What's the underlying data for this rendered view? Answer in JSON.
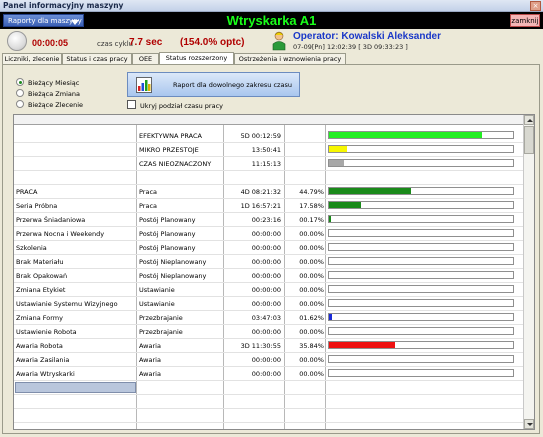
{
  "window": {
    "title": "Panel informacyjny maszyny",
    "close_glyph": "×"
  },
  "topbar": {
    "reports_button": "Raporty dla maszyny",
    "machine_title": "Wtryskarka A1",
    "close_button": "zamknij",
    "title_color": "#19ff19"
  },
  "info": {
    "timer": "00:00:05",
    "cycle_label": "czas cyklu",
    "cycle_value": "7.7 sec",
    "cycle_percent": "(154.0% optc)",
    "operator": "Operator:  Kowalski Aleksander",
    "operator_time": "07-09[Pn] 12:02:39  [ 3D 09:33:23 ]"
  },
  "tabs": [
    {
      "label": "Liczniki, zlecenie"
    },
    {
      "label": "Status i czas pracy"
    },
    {
      "label": "OEE"
    },
    {
      "label": "Status rozszerzony",
      "active": true
    },
    {
      "label": "Ostrzeżenia i wznowienia pracy"
    }
  ],
  "period": {
    "options": [
      "Bieżący Miesiąc",
      "Bieżąca Zmiana",
      "Bieżące Zlecenie"
    ],
    "selected": "Bieżący Miesiąc"
  },
  "report_button": "Raport dla dowolnego zakresu czasu",
  "hide_split_label": "Ukryj podział czasu pracy",
  "table": {
    "summary_rows": [
      {
        "category": "EFEKTYWNA PRACA",
        "time": "5D 00:12:59",
        "percent": "",
        "fraction": 0.83,
        "color": "#22ee22"
      },
      {
        "category": "MIKRO PRZESTOJE",
        "time": "13:50:41",
        "percent": "",
        "fraction": 0.1,
        "color": "#f7f700"
      },
      {
        "category": "CZAS NIEOZNACZONY",
        "time": "11:15:13",
        "percent": "",
        "fraction": 0.08,
        "color": "#a8a8a8"
      }
    ],
    "rows": [
      {
        "name": "PRACA",
        "category": "Praca",
        "time": "4D 08:21:32",
        "percent": "44.79%",
        "fraction": 0.448,
        "color": "#1a8a1a"
      },
      {
        "name": "Seria Próbna",
        "category": "Praca",
        "time": "1D 16:57:21",
        "percent": "17.58%",
        "fraction": 0.176,
        "color": "#1a8a1a"
      },
      {
        "name": "Przerwa Śniadaniowa",
        "category": "Postój Planowany",
        "time": "00:23:16",
        "percent": "00.17%",
        "fraction": 0.0017,
        "color": "#1a8a1a"
      },
      {
        "name": "Przerwa Nocna i Weekendy",
        "category": "Postój Planowany",
        "time": "00:00:00",
        "percent": "00.00%",
        "fraction": 0,
        "color": "#1a8a1a"
      },
      {
        "name": "Szkolenia",
        "category": "Postój Planowany",
        "time": "00:00:00",
        "percent": "00.00%",
        "fraction": 0,
        "color": "#1a8a1a"
      },
      {
        "name": "Brak Materiału",
        "category": "Postój Nieplanowany",
        "time": "00:00:00",
        "percent": "00.00%",
        "fraction": 0,
        "color": "#1a8a1a"
      },
      {
        "name": "Brak Opakowań",
        "category": "Postój Nieplanowany",
        "time": "00:00:00",
        "percent": "00.00%",
        "fraction": 0,
        "color": "#1a8a1a"
      },
      {
        "name": "Zmiana Etykiet",
        "category": "Ustawianie",
        "time": "00:00:00",
        "percent": "00.00%",
        "fraction": 0,
        "color": "#1a8a1a"
      },
      {
        "name": "Ustawianie Systemu Wizyjnego",
        "category": "Ustawianie",
        "time": "00:00:00",
        "percent": "00.00%",
        "fraction": 0,
        "color": "#1a8a1a"
      },
      {
        "name": "Zmiana Formy",
        "category": "Przezbrajanie",
        "time": "03:47:03",
        "percent": "01.62%",
        "fraction": 0.0162,
        "color": "#1a2ad8"
      },
      {
        "name": "Ustawienie Robota",
        "category": "Przezbrajanie",
        "time": "00:00:00",
        "percent": "00.00%",
        "fraction": 0,
        "color": "#1a8a1a"
      },
      {
        "name": "Awaria Robota",
        "category": "Awaria",
        "time": "3D 11:30:55",
        "percent": "35.84%",
        "fraction": 0.358,
        "color": "#ee1111"
      },
      {
        "name": "Awaria Zasilania",
        "category": "Awaria",
        "time": "00:00:00",
        "percent": "00.00%",
        "fraction": 0,
        "color": "#1a8a1a"
      },
      {
        "name": "Awaria Wtryskarki",
        "category": "Awaria",
        "time": "00:00:00",
        "percent": "00.00%",
        "fraction": 0,
        "color": "#1a8a1a"
      }
    ]
  }
}
